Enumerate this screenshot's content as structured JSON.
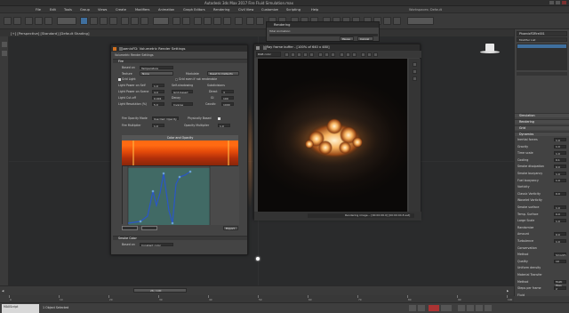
{
  "window": {
    "title": "Autodesk 3ds Max 2017  Fire Fluid Simulation.max"
  },
  "menu": [
    "File",
    "Edit",
    "Tools",
    "Group",
    "Views",
    "Create",
    "Modifiers",
    "Animation",
    "Graph Editors",
    "Rendering",
    "Civil View",
    "Customize",
    "Scripting",
    "Help"
  ],
  "workspace": {
    "label": "Workspaces: Default"
  },
  "viewport": {
    "label": "[+] [Perspective] [Standard] [Default Shading]"
  },
  "phoenix": {
    "title": "PhoenixFD: Volumetric Render Settings",
    "subtitle": "Volumetric Render Settings",
    "fire_section": "Fire",
    "based_on_label": "Based on",
    "based_on_value": "Temperature",
    "texture_label": "Texture",
    "texture_value": "None",
    "modulate_label": "Modulate",
    "reset_button": "Reset to Defaults",
    "grid_light_label": "Grid Light",
    "grid_even_label": "Grid even if not renderable",
    "light_power_self_label": "Light Power on Self",
    "light_power_self_value": "1.0",
    "self_shadowing_label": "Self-shadowing",
    "self_shadowing_value": "Grid-based",
    "light_power_scene_label": "Light Power on Scene",
    "light_power_scene_value": "4.0",
    "decay_label": "Decay",
    "decay_value": "Inverse",
    "light_cutoff_label": "Light Cut-off",
    "light_cutoff_value": "0.001",
    "light_resolution_label": "Light Resolution (%)",
    "light_resolution_value": "5.0",
    "subdivisions_label": "Subdivisions",
    "direct_label": "Direct",
    "direct_value": "3",
    "gi_label": "GI",
    "gi_value": "100",
    "caustic_label": "Caustic",
    "caustic_value": "1000",
    "opacity_mode_label": "Fire Opacity Mode",
    "opacity_mode_value": "Use Own Opacity",
    "physically_based_label": "Physically Based",
    "fire_multiplier_label": "Fire Multiplier",
    "fire_multiplier_value": "1.0",
    "opacity_multiplier_label": "Opacity Multiplier",
    "opacity_multiplier_value": "1.0",
    "color_opacity_label": "Color and Opacity",
    "smoke_section": "Smoke Color",
    "smoke_based_label": "Based on",
    "smoke_based_value": "Constant color",
    "export_button": "Export"
  },
  "rendering": {
    "title": "Rendering",
    "total_label": "Total Animation:",
    "pause_button": "Pause",
    "cancel_button": "Cancel"
  },
  "vfb": {
    "title": "V-Ray frame buffer - [100% of 640 x 480]",
    "channel_value": "RGB color",
    "status_text": "Rendering image... [00:00:06.0] [00:00:04.8 est]"
  },
  "command_panel": {
    "object_name": "PhoenixFDFire001",
    "modifier_list": "Modifier List",
    "sections": [
      "Simulation",
      "Rendering",
      "Dynamics",
      "Grid"
    ],
    "rows": [
      {
        "label": "Inertial forces",
        "value": "1.0"
      },
      {
        "label": "Gravity",
        "value": "1.0"
      },
      {
        "label": "Time scale",
        "value": "1.0"
      },
      {
        "label": "Cooling",
        "value": "0.1"
      },
      {
        "label": "Smoke dissipation",
        "value": "0.0"
      },
      {
        "label": "Smoke buoyancy",
        "value": "1.0"
      },
      {
        "label": "Fuel buoyancy",
        "value": "1.0"
      },
      {
        "label": "Vorticity",
        "value": ""
      },
      {
        "label": "Classic Vorticity",
        "value": "0.0"
      },
      {
        "label": "Wavelet Vorticity",
        "value": ""
      },
      {
        "label": "Smoke surface",
        "value": "1.0"
      },
      {
        "label": "Temp. Surface",
        "value": "0.0"
      },
      {
        "label": "Large Scale",
        "value": "1.0"
      },
      {
        "label": "Randomize",
        "value": ""
      },
      {
        "label": "Amount",
        "value": "0.0"
      },
      {
        "label": "Turbulence",
        "value": "1.0"
      },
      {
        "label": "Conservation",
        "value": ""
      },
      {
        "label": "Method",
        "value": "Smooth"
      },
      {
        "label": "Quality",
        "value": "10"
      },
      {
        "label": "Uniform density",
        "value": ""
      },
      {
        "label": "Material Transfer",
        "value": ""
      },
      {
        "label": "Method",
        "value": "Multi Pass"
      },
      {
        "label": "Steps per frame",
        "value": "2"
      },
      {
        "label": "Fluid",
        "value": ""
      }
    ]
  },
  "timeline": {
    "frame": "26 / 100",
    "ticks": [
      "0",
      "10",
      "20",
      "30",
      "40",
      "50",
      "60",
      "70",
      "80",
      "90",
      "100"
    ]
  },
  "status": {
    "selected": "1 Object Selected",
    "maxscript": "MAXScript"
  },
  "colors": {
    "accent": "#3f6f9e",
    "fire": "#ff6a12"
  }
}
